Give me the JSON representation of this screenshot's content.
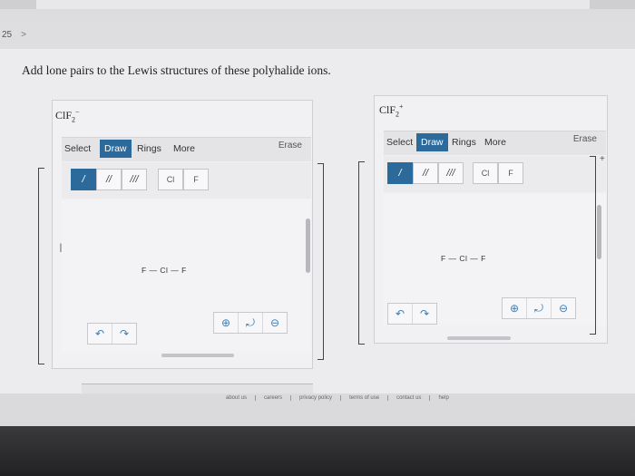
{
  "question": {
    "number": "25",
    "chevron": ">"
  },
  "prompt": "Add lone pairs to the Lewis structures of these polyhalide ions.",
  "panels": [
    {
      "formula_main": "ClF",
      "formula_sub": "2",
      "formula_sup": "−",
      "tabs": {
        "select": "Select",
        "draw": "Draw",
        "rings": "Rings",
        "more": "More"
      },
      "erase": "Erase",
      "bonds": {
        "single": "/",
        "double": "//",
        "triple": "///"
      },
      "elements": [
        "Cl",
        "F"
      ],
      "molecule": "F — Cl — F"
    },
    {
      "formula_main": "ClF",
      "formula_sub": "2",
      "formula_sup": "+",
      "tabs": {
        "select": "Select",
        "draw": "Draw",
        "rings": "Rings",
        "more": "More"
      },
      "erase": "Erase",
      "bonds": {
        "single": "/",
        "double": "//",
        "triple": "///"
      },
      "elements": [
        "Cl",
        "F"
      ],
      "molecule": "F — Cl — F"
    }
  ],
  "charge_label": "+",
  "footer": [
    "about us",
    "careers",
    "privacy policy",
    "terms of use",
    "contact us",
    "help"
  ]
}
